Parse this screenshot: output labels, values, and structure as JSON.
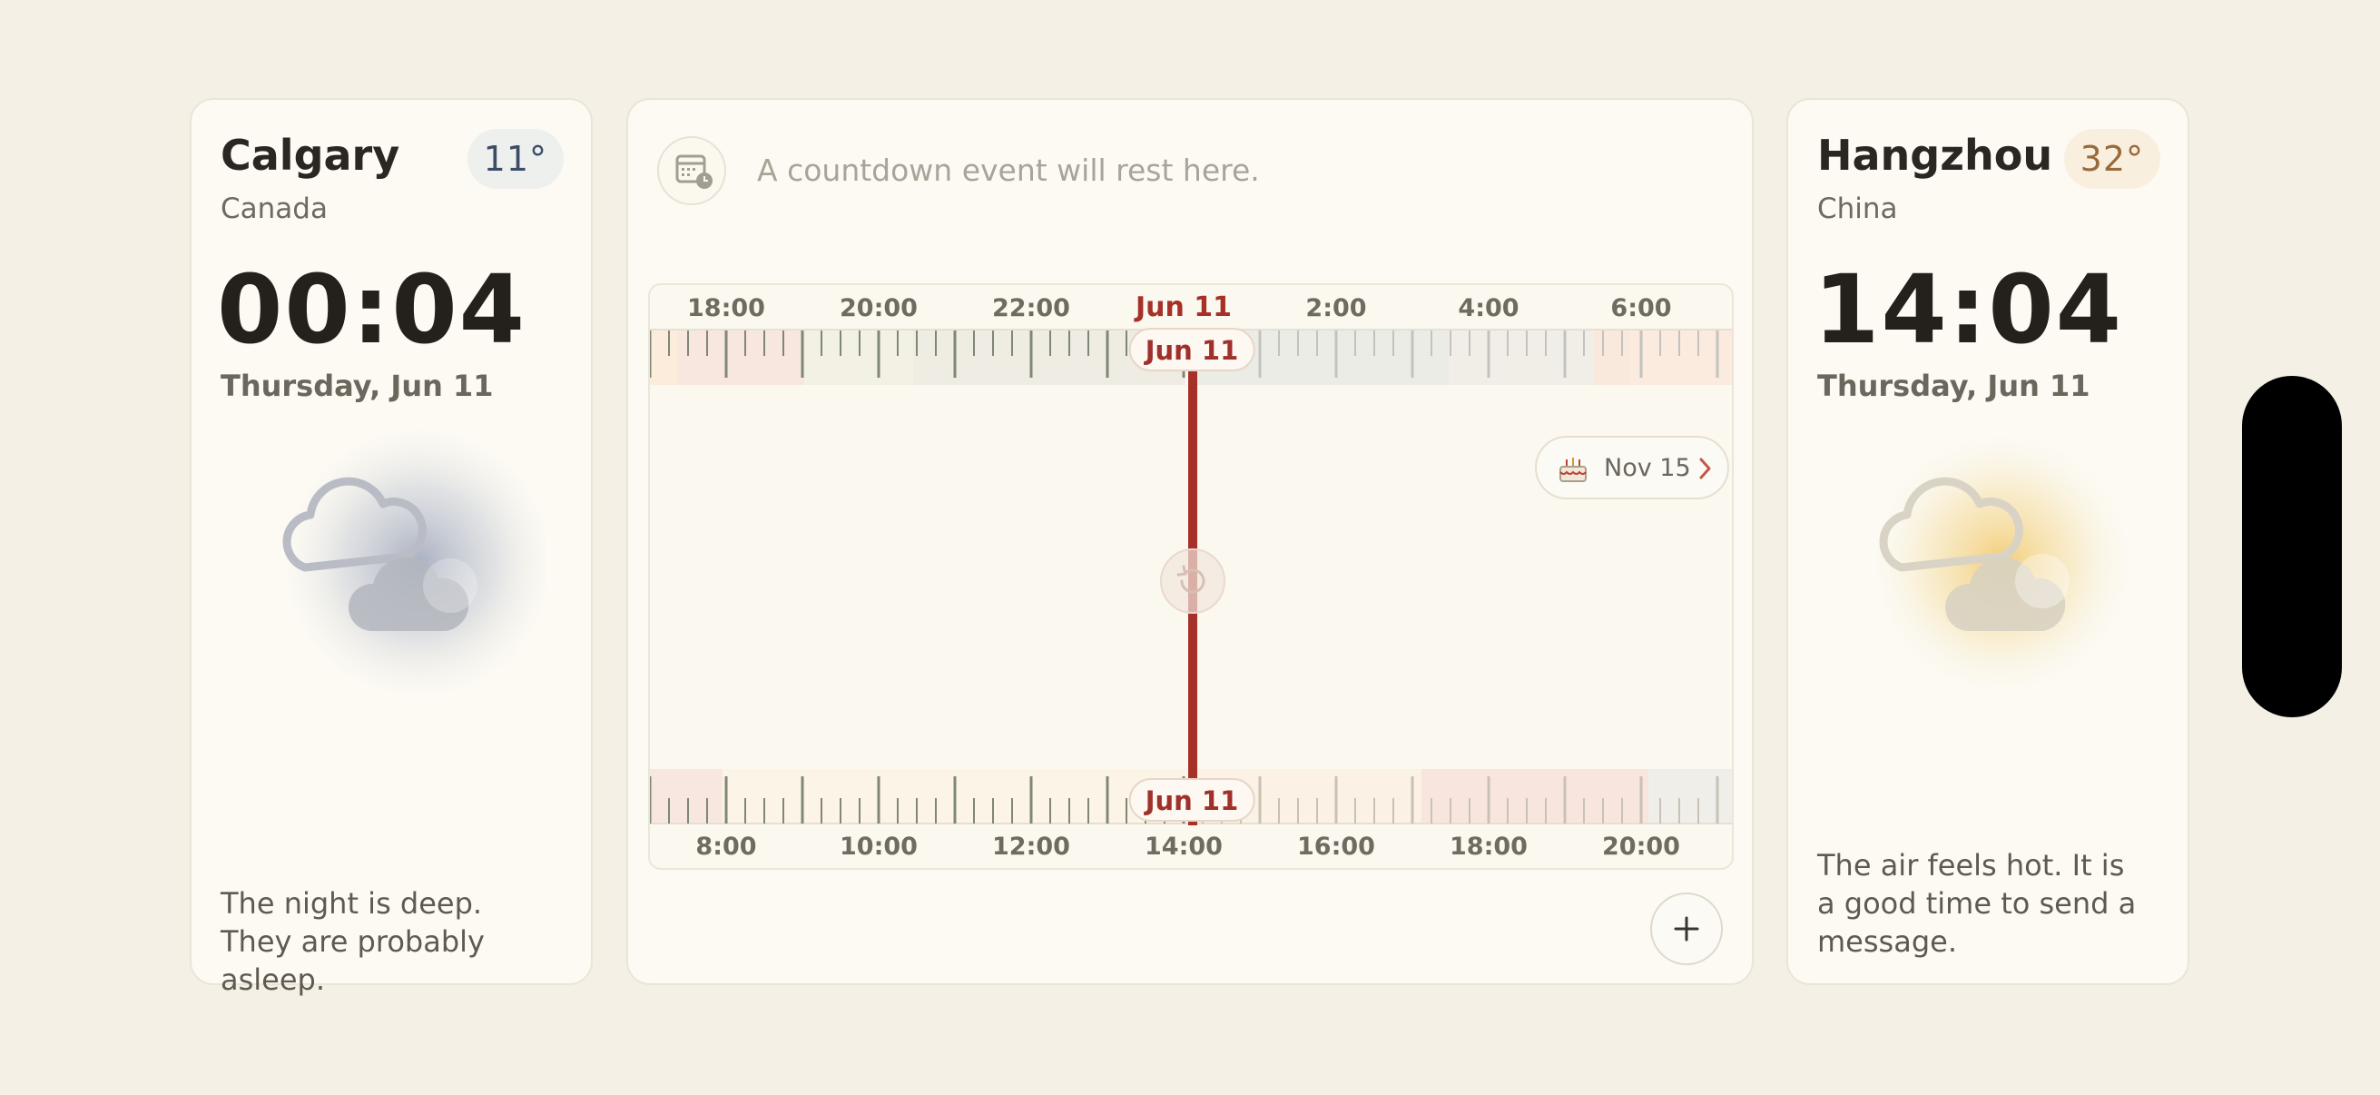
{
  "left_city": {
    "name": "Calgary",
    "country": "Canada",
    "temperature": "11°",
    "time": "00:04",
    "date": "Thursday, Jun 11",
    "weather_icon": "cloudy-night-icon",
    "message": "The night is deep. They are probably asleep."
  },
  "right_city": {
    "name": "Hangzhou",
    "country": "China",
    "temperature": "32°",
    "time": "14:04",
    "date": "Thursday, Jun 11",
    "weather_icon": "cloudy-sunny-icon",
    "message": "The air feels hot. It is a good time to send a message."
  },
  "countdown": {
    "placeholder": "A countdown event will rest here.",
    "icon": "calendar-clock-icon"
  },
  "timeline": {
    "top_labels": [
      "18:00",
      "20:00",
      "22:00",
      "Jun 11",
      "2:00",
      "4:00",
      "6:00"
    ],
    "bottom_labels": [
      "8:00",
      "10:00",
      "12:00",
      "14:00",
      "16:00",
      "18:00",
      "20:00"
    ],
    "top_now_pill": "Jun 11",
    "bottom_now_pill": "Jun 11",
    "event_chip": {
      "icon": "birthday-cake-icon",
      "label": "Nov 15"
    },
    "reset_icon": "reset-icon",
    "accent": "#a63128"
  },
  "add_button_icon": "plus-icon"
}
